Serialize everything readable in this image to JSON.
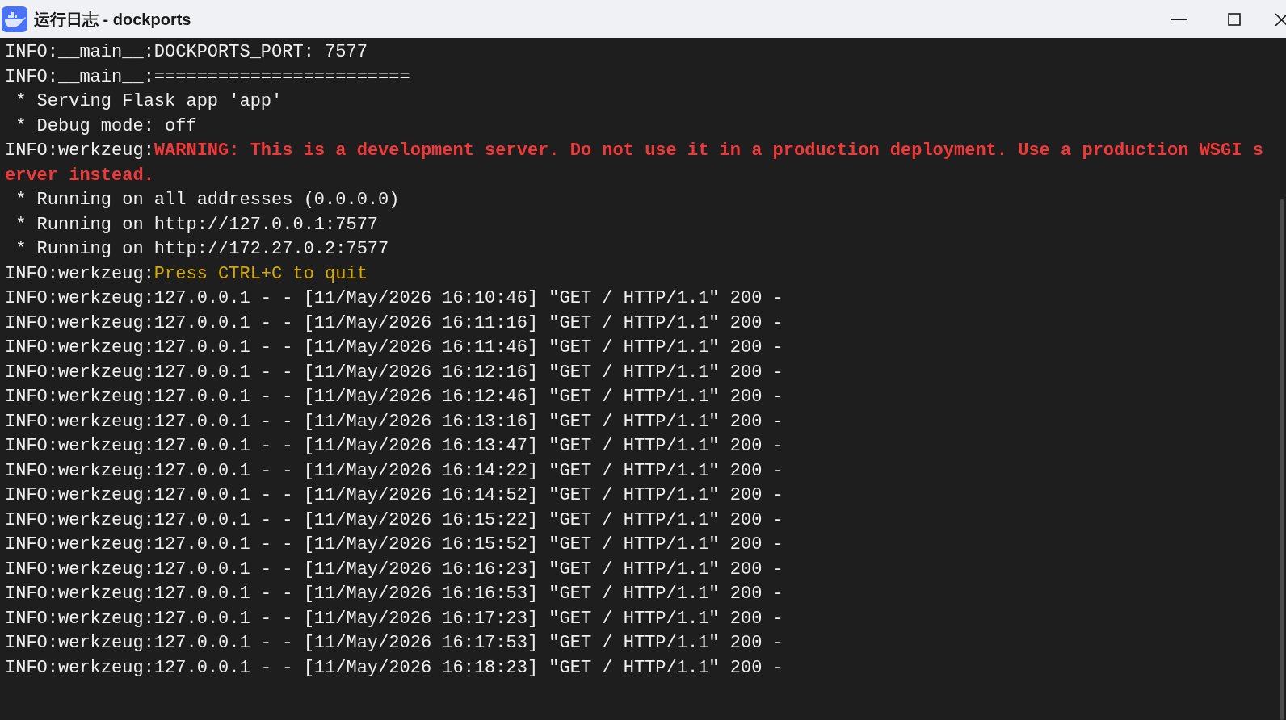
{
  "window": {
    "title": "运行日志 - dockports"
  },
  "log_lines": [
    {
      "kind": "plain",
      "text": "INFO:__main__:DOCKPORTS_PORT: 7577"
    },
    {
      "kind": "plain",
      "text": "INFO:__main__:========================"
    },
    {
      "kind": "plain",
      "text": " * Serving Flask app 'app'"
    },
    {
      "kind": "plain",
      "text": " * Debug mode: off"
    },
    {
      "kind": "warning",
      "prefix": "INFO:werkzeug:",
      "text": "WARNING: This is a development server. Do not use it in a production deployment. Use a production WSGI server instead."
    },
    {
      "kind": "plain",
      "text": " * Running on all addresses (0.0.0.0)"
    },
    {
      "kind": "plain",
      "text": " * Running on http://127.0.0.1:7577"
    },
    {
      "kind": "plain",
      "text": " * Running on http://172.27.0.2:7577"
    },
    {
      "kind": "notice",
      "prefix": "INFO:werkzeug:",
      "text": "Press CTRL+C to quit"
    },
    {
      "kind": "plain",
      "text": "INFO:werkzeug:127.0.0.1 - - [11/May/2026 16:10:46] \"GET / HTTP/1.1\" 200 -"
    },
    {
      "kind": "plain",
      "text": "INFO:werkzeug:127.0.0.1 - - [11/May/2026 16:11:16] \"GET / HTTP/1.1\" 200 -"
    },
    {
      "kind": "plain",
      "text": "INFO:werkzeug:127.0.0.1 - - [11/May/2026 16:11:46] \"GET / HTTP/1.1\" 200 -"
    },
    {
      "kind": "plain",
      "text": "INFO:werkzeug:127.0.0.1 - - [11/May/2026 16:12:16] \"GET / HTTP/1.1\" 200 -"
    },
    {
      "kind": "plain",
      "text": "INFO:werkzeug:127.0.0.1 - - [11/May/2026 16:12:46] \"GET / HTTP/1.1\" 200 -"
    },
    {
      "kind": "plain",
      "text": "INFO:werkzeug:127.0.0.1 - - [11/May/2026 16:13:16] \"GET / HTTP/1.1\" 200 -"
    },
    {
      "kind": "plain",
      "text": "INFO:werkzeug:127.0.0.1 - - [11/May/2026 16:13:47] \"GET / HTTP/1.1\" 200 -"
    },
    {
      "kind": "plain",
      "text": "INFO:werkzeug:127.0.0.1 - - [11/May/2026 16:14:22] \"GET / HTTP/1.1\" 200 -"
    },
    {
      "kind": "plain",
      "text": "INFO:werkzeug:127.0.0.1 - - [11/May/2026 16:14:52] \"GET / HTTP/1.1\" 200 -"
    },
    {
      "kind": "plain",
      "text": "INFO:werkzeug:127.0.0.1 - - [11/May/2026 16:15:22] \"GET / HTTP/1.1\" 200 -"
    },
    {
      "kind": "plain",
      "text": "INFO:werkzeug:127.0.0.1 - - [11/May/2026 16:15:52] \"GET / HTTP/1.1\" 200 -"
    },
    {
      "kind": "plain",
      "text": "INFO:werkzeug:127.0.0.1 - - [11/May/2026 16:16:23] \"GET / HTTP/1.1\" 200 -"
    },
    {
      "kind": "plain",
      "text": "INFO:werkzeug:127.0.0.1 - - [11/May/2026 16:16:53] \"GET / HTTP/1.1\" 200 -"
    },
    {
      "kind": "plain",
      "text": "INFO:werkzeug:127.0.0.1 - - [11/May/2026 16:17:23] \"GET / HTTP/1.1\" 200 -"
    },
    {
      "kind": "plain",
      "text": "INFO:werkzeug:127.0.0.1 - - [11/May/2026 16:17:53] \"GET / HTTP/1.1\" 200 -"
    },
    {
      "kind": "plain",
      "text": "INFO:werkzeug:127.0.0.1 - - [11/May/2026 16:18:23] \"GET / HTTP/1.1\" 200 -"
    }
  ]
}
